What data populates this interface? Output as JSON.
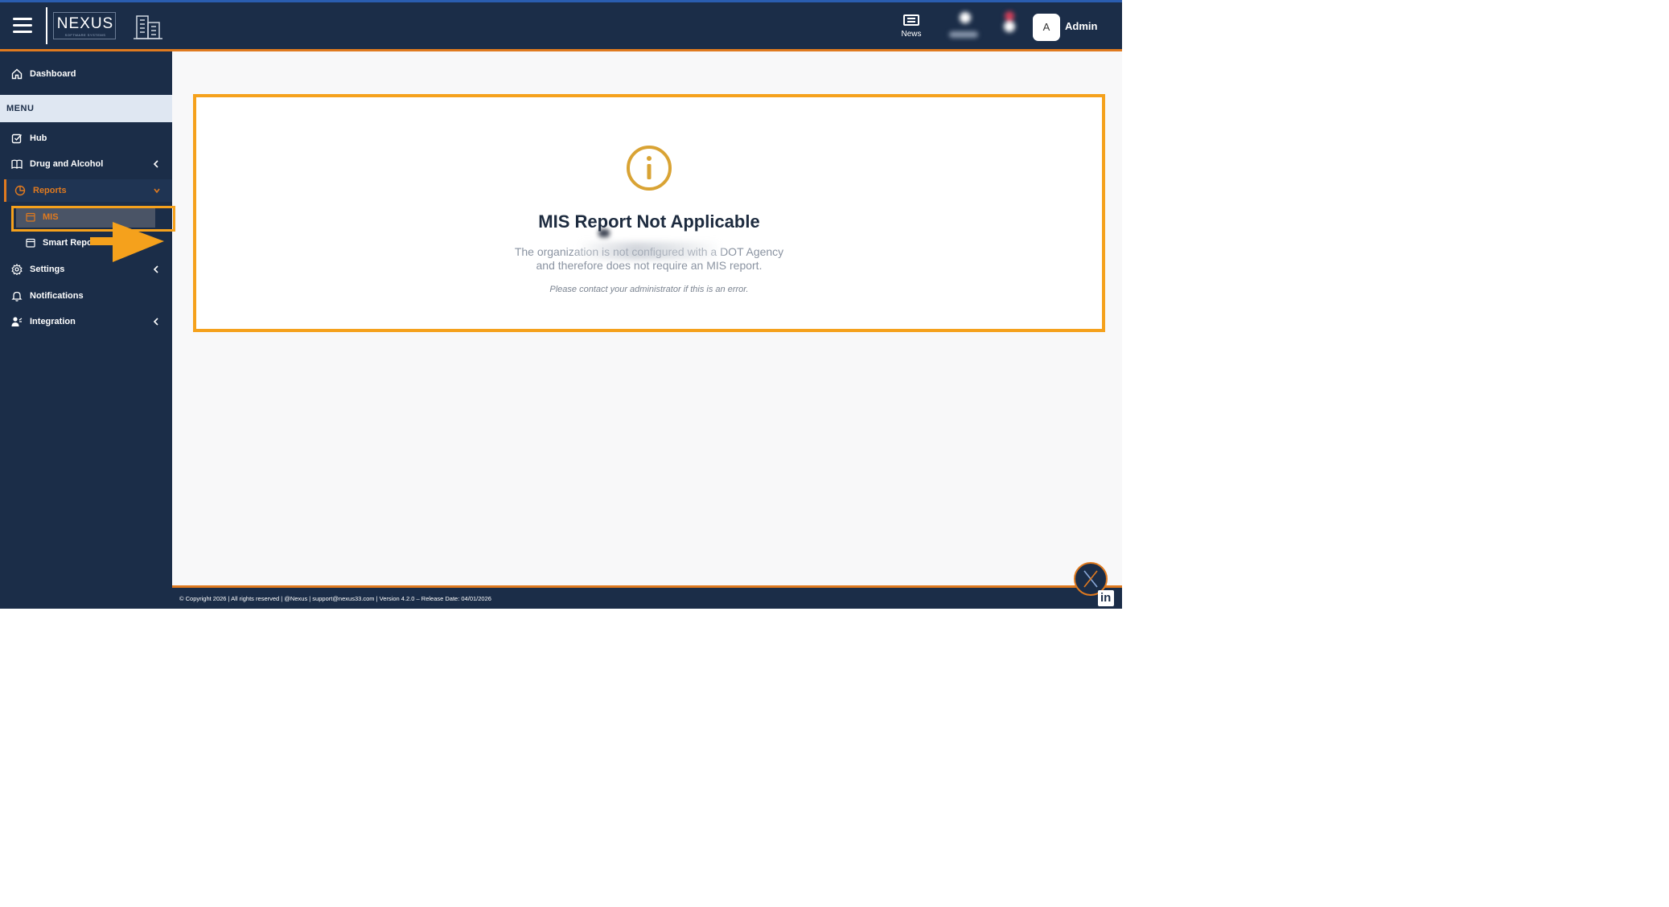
{
  "header": {
    "logo_text": "NEXUS",
    "logo_subtitle": "SOFTWARE SYSTEMS",
    "news_label": "News",
    "user_initial": "A",
    "user_name": "Admin"
  },
  "sidebar": {
    "dashboard": "Dashboard",
    "menu_header": "MENU",
    "items": [
      {
        "label": "Hub"
      },
      {
        "label": "Drug and Alcohol"
      },
      {
        "label": "Reports"
      },
      {
        "label": "Settings"
      },
      {
        "label": "Notifications"
      },
      {
        "label": "Integration"
      }
    ],
    "reports_sub": [
      {
        "label": "MIS"
      },
      {
        "label": "Smart Report"
      }
    ]
  },
  "main": {
    "title": "MIS Report Not Applicable",
    "message_line1": "The organization is not configured with a DOT Agency",
    "message_line2": "and therefore does not require an MIS report.",
    "note": "Please contact your administrator if this is an error."
  },
  "footer": {
    "text": "© Copyright 2026 | All rights reserved | @Nexus | support@nexus33.com | Version 4.2.0 – Release Date: 04/01/2026",
    "linkedin": "in"
  },
  "colors": {
    "navy": "#1b2d48",
    "accent_orange": "#e07a1f",
    "highlight": "#f5a11c",
    "info_icon": "#d9a334"
  }
}
